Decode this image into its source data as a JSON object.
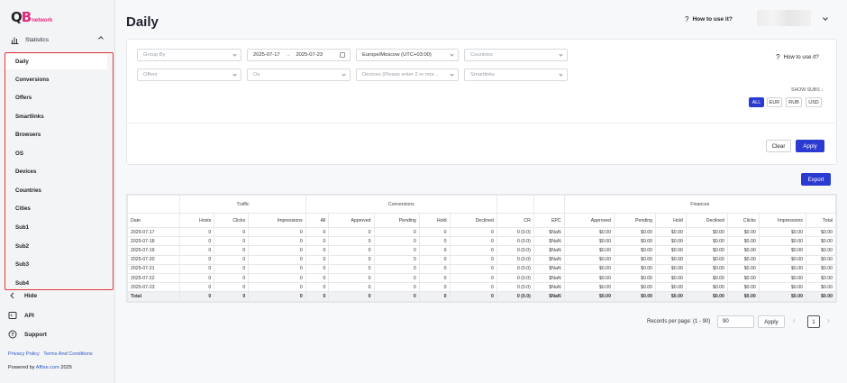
{
  "logo": {
    "mark_a": "Q",
    "mark_b": "B",
    "sub": "network"
  },
  "sidebar": {
    "section": "Statistics",
    "items": [
      "Daily",
      "Conversions",
      "Offers",
      "Smartlinks",
      "Browsers",
      "OS",
      "Devices",
      "Countries",
      "Cities",
      "Sub1",
      "Sub2",
      "Sub3",
      "Sub4"
    ],
    "active": "Daily",
    "hide": "Hide",
    "api": "API",
    "support": "Support",
    "privacy": "Privacy Policy",
    "terms": "Terms And Conditions",
    "powered_prefix": "Powered by ",
    "powered_brand": "Affise.com",
    "powered_year": " 2025"
  },
  "header": {
    "title": "Daily",
    "howto": "How to use it?"
  },
  "filters": {
    "group_by": "Group By",
    "date_from": "2025-07-17",
    "date_to": "2025-07-23",
    "timezone": "Europe/Moscow (UTC+03:00)",
    "countries": "Countries",
    "offers": "Offers",
    "os": "Os",
    "devices": "Devices (Please enter 2 or mor...",
    "smartlinks": "Smartlinks",
    "howto": "How to use it?",
    "show_subs": "SHOW SUBS",
    "currencies": [
      "ALL",
      "EUR",
      "RUB",
      "USD"
    ],
    "active_currency": "ALL",
    "clear": "Clear",
    "apply": "Apply"
  },
  "export": "Export",
  "table": {
    "groups": [
      "Traffic",
      "Conversions",
      "Finances"
    ],
    "columns": [
      "Date",
      "Hosts",
      "Clicks",
      "Impressions",
      "All",
      "Approved",
      "Pending",
      "Hold",
      "Declined",
      "CR",
      "EPC",
      "Approved",
      "Pending",
      "Hold",
      "Declined",
      "Clicks",
      "Impressions",
      "Total"
    ],
    "rows": [
      [
        "2025-07-17",
        "0",
        "0",
        "0",
        "0",
        "0",
        "0",
        "0",
        "0",
        "0 (0.0)",
        "$NaN",
        "$0.00",
        "$0.00",
        "$0.00",
        "$0.00",
        "$0.00",
        "$0.00",
        "$0.00"
      ],
      [
        "2025-07-18",
        "0",
        "0",
        "0",
        "0",
        "0",
        "0",
        "0",
        "0",
        "0 (0.0)",
        "$NaN",
        "$0.00",
        "$0.00",
        "$0.00",
        "$0.00",
        "$0.00",
        "$0.00",
        "$0.00"
      ],
      [
        "2025-07-19",
        "0",
        "0",
        "0",
        "0",
        "0",
        "0",
        "0",
        "0",
        "0 (0.0)",
        "$NaN",
        "$0.00",
        "$0.00",
        "$0.00",
        "$0.00",
        "$0.00",
        "$0.00",
        "$0.00"
      ],
      [
        "2025-07-20",
        "0",
        "0",
        "0",
        "0",
        "0",
        "0",
        "0",
        "0",
        "0 (0.0)",
        "$NaN",
        "$0.00",
        "$0.00",
        "$0.00",
        "$0.00",
        "$0.00",
        "$0.00",
        "$0.00"
      ],
      [
        "2025-07-21",
        "0",
        "0",
        "0",
        "0",
        "0",
        "0",
        "0",
        "0",
        "0 (0.0)",
        "$NaN",
        "$0.00",
        "$0.00",
        "$0.00",
        "$0.00",
        "$0.00",
        "$0.00",
        "$0.00"
      ],
      [
        "2025-07-22",
        "0",
        "0",
        "0",
        "0",
        "0",
        "0",
        "0",
        "0",
        "0 (0.0)",
        "$NaN",
        "$0.00",
        "$0.00",
        "$0.00",
        "$0.00",
        "$0.00",
        "$0.00",
        "$0.00"
      ],
      [
        "2025-07-23",
        "0",
        "0",
        "0",
        "0",
        "0",
        "0",
        "0",
        "0",
        "0 (0.0)",
        "$NaN",
        "$0.00",
        "$0.00",
        "$0.00",
        "$0.00",
        "$0.00",
        "$0.00",
        "$0.00"
      ]
    ],
    "total": [
      "Total",
      "0",
      "0",
      "0",
      "0",
      "0",
      "0",
      "0",
      "0",
      "0 (0.0)",
      "$NaN",
      "$0.00",
      "$0.00",
      "$0.00",
      "$0.00",
      "$0.00",
      "$0.00",
      "$0.00"
    ]
  },
  "pagination": {
    "records_label": "Records per page: (1 - 90)",
    "per_page": "90",
    "apply": "Apply",
    "prev": "‹",
    "page": "1",
    "next": "›"
  },
  "colors": {
    "accent": "#2b3bd1",
    "brand": "#e0287c",
    "highlight": "#e0393b"
  }
}
